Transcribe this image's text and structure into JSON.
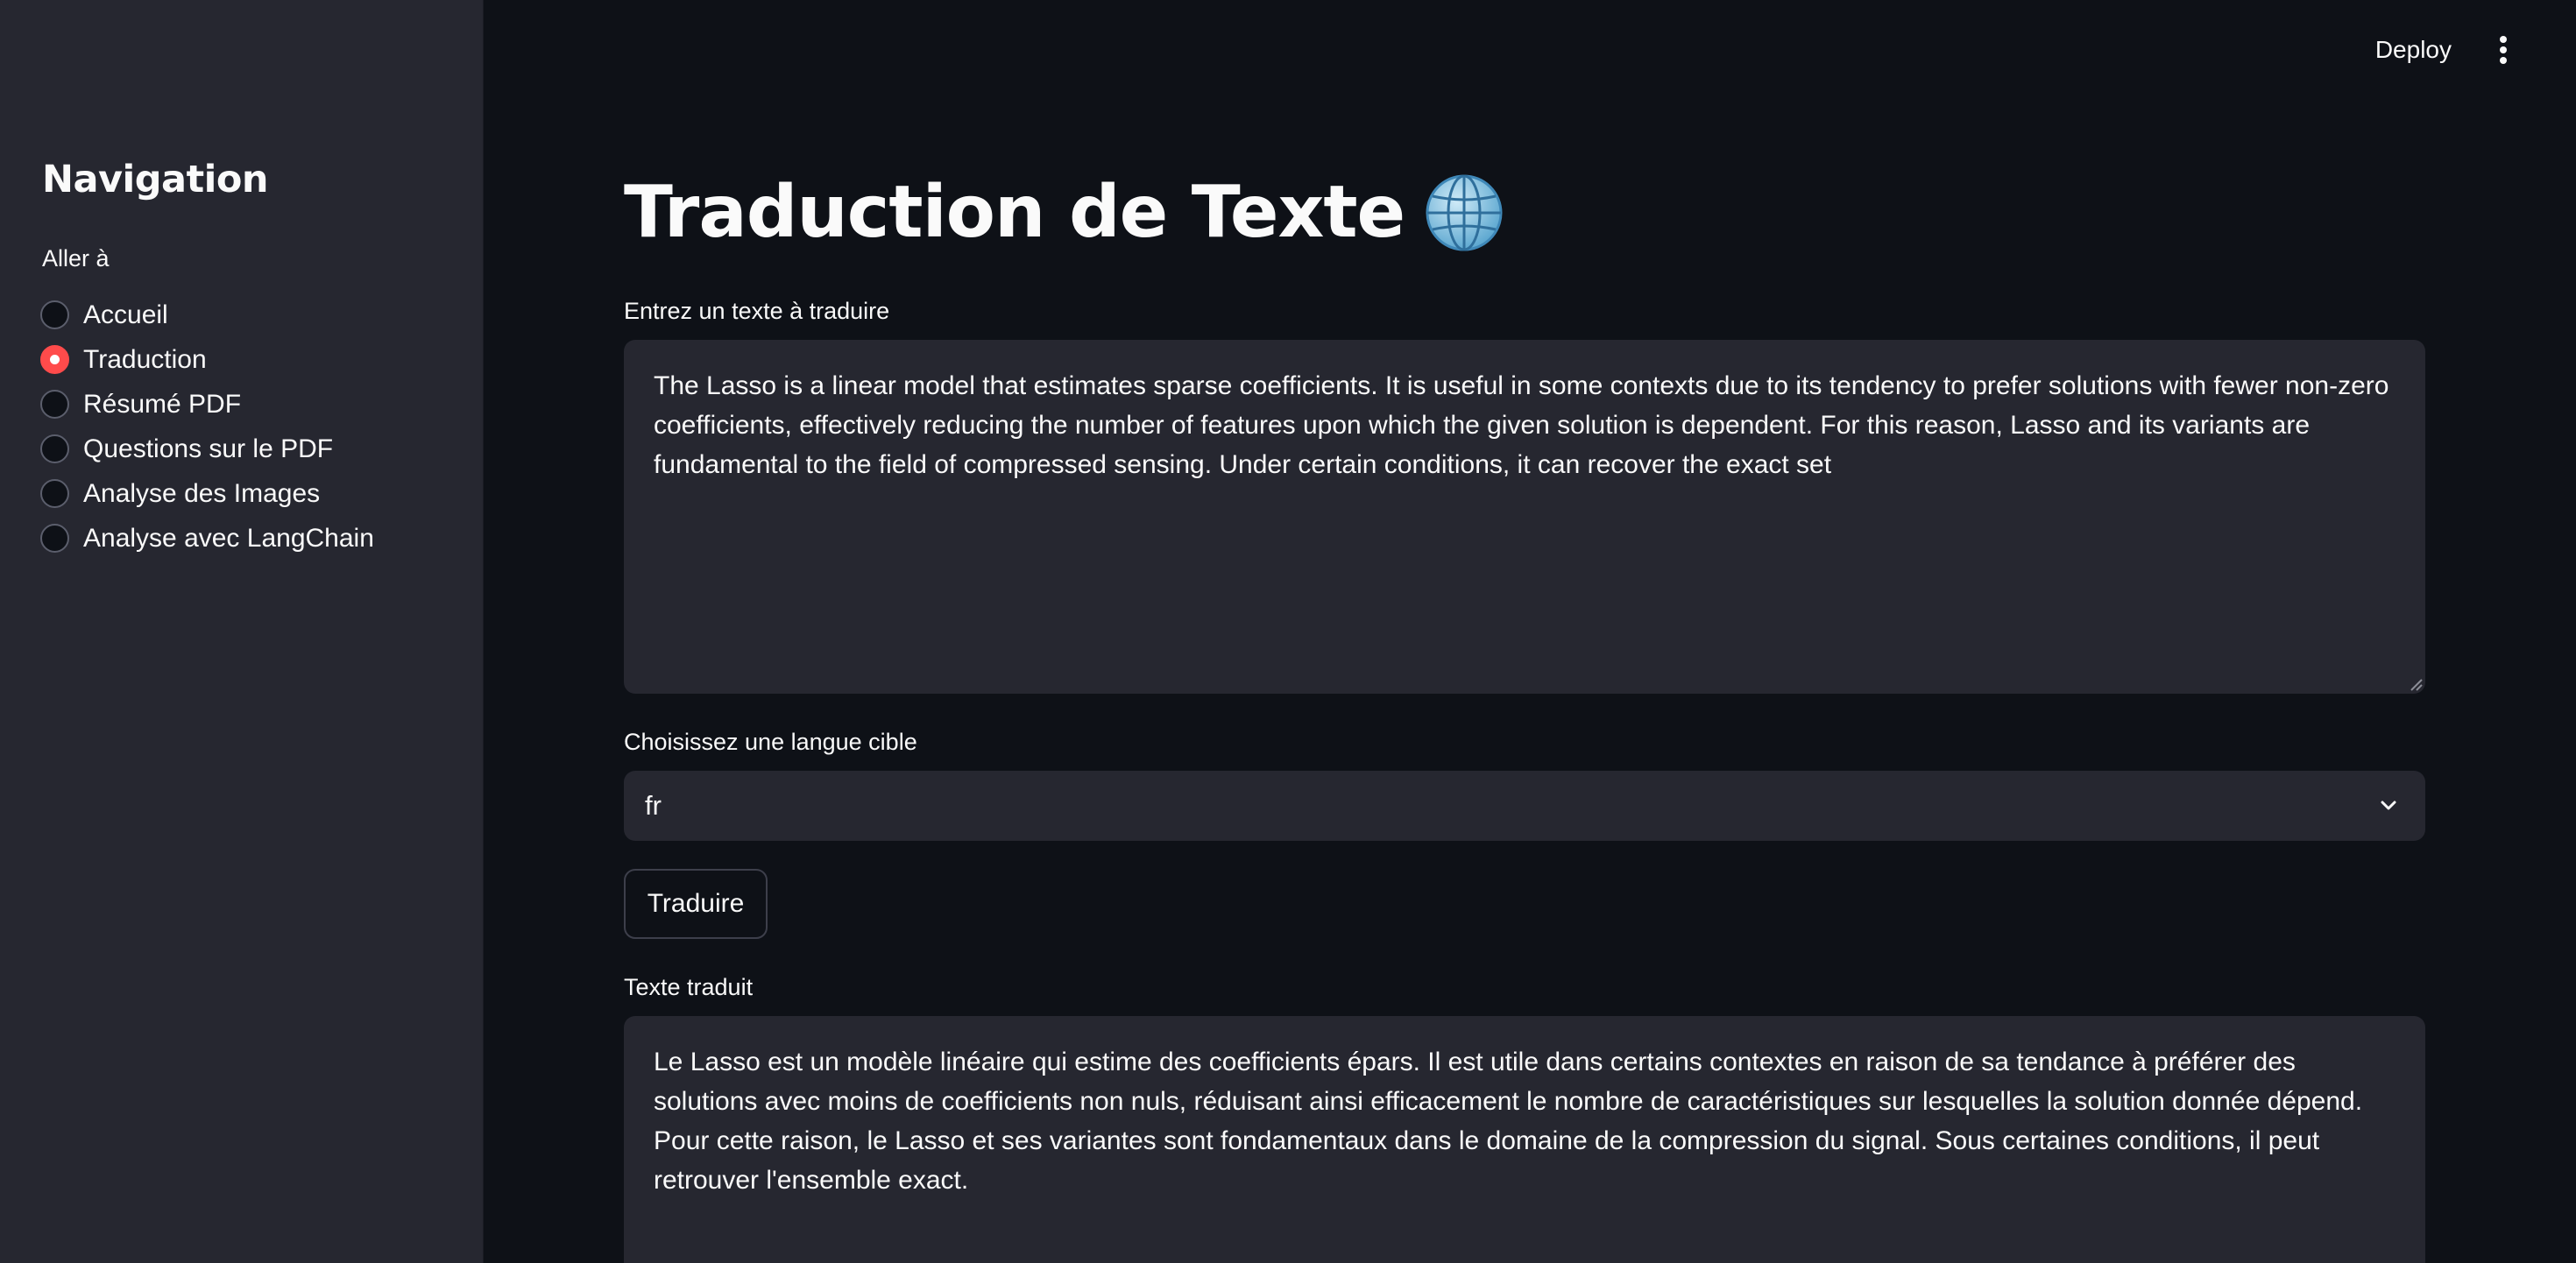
{
  "header": {
    "deploy_label": "Deploy",
    "menu_icon": "kebab-vertical-icon"
  },
  "sidebar": {
    "title": "Navigation",
    "radio_caption": "Aller à",
    "items": [
      {
        "label": "Accueil",
        "selected": false
      },
      {
        "label": "Traduction",
        "selected": true
      },
      {
        "label": "Résumé PDF",
        "selected": false
      },
      {
        "label": "Questions sur le PDF",
        "selected": false
      },
      {
        "label": "Analyse des Images",
        "selected": false
      },
      {
        "label": "Analyse avec LangChain",
        "selected": false
      }
    ]
  },
  "main": {
    "title": "Traduction de Texte",
    "title_icon": "globe-icon",
    "input_label": "Entrez un texte à traduire",
    "input_value": "The Lasso is a linear model that estimates sparse coefficients. It is useful in some contexts due to its tendency to prefer solutions with fewer non-zero coefficients, effectively reducing the number of features upon which the given solution is dependent. For this reason, Lasso and its variants are fundamental to the field of compressed sensing. Under certain conditions, it can recover the exact set",
    "language_label": "Choisissez une langue cible",
    "language_value": "fr",
    "translate_button": "Traduire",
    "output_label": "Texte traduit",
    "output_value": "Le Lasso est un modèle linéaire qui estime des coefficients épars. Il est utile dans certains contextes en raison de sa tendance à préférer des solutions avec moins de coefficients non nuls, réduisant ainsi efficacement le nombre de caractéristiques sur lesquelles la solution donnée dépend. Pour cette raison, le Lasso et ses variantes sont fondamentaux dans le domaine de la compression du signal. Sous certaines conditions, il peut retrouver l'ensemble exact."
  },
  "colors": {
    "background": "#0e1117",
    "sidebar": "#262730",
    "widget": "#262730",
    "accent": "#ff4b4b",
    "text": "#fafafa"
  }
}
